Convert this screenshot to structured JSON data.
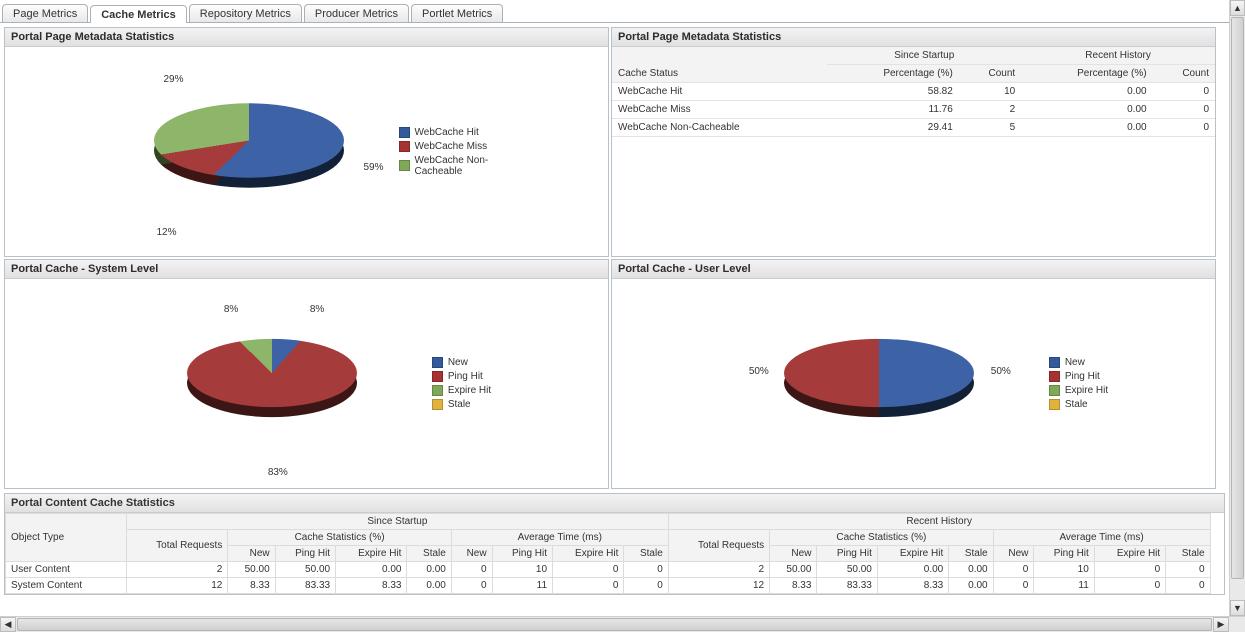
{
  "tabs": [
    "Page Metrics",
    "Cache Metrics",
    "Repository Metrics",
    "Producer Metrics",
    "Portlet Metrics"
  ],
  "tabs_active_index": 1,
  "panel_titles": {
    "meta_pie": "Portal Page Metadata Statistics",
    "meta_table": "Portal Page Metadata Statistics",
    "cache_system": "Portal Cache - System Level",
    "cache_user": "Portal Cache - User Level",
    "content": "Portal Content Cache Statistics"
  },
  "colors": {
    "blue": "#3d63a6",
    "red": "#a63b3b",
    "green": "#8eb66a",
    "orange": "#e2b33c"
  },
  "legend_webcache": [
    "WebCache Hit",
    "WebCache Miss",
    "WebCache Non-Cacheable"
  ],
  "legend_cache": [
    "New",
    "Ping Hit",
    "Expire Hit",
    "Stale"
  ],
  "meta_table": {
    "headers": {
      "cache_status": "Cache Status",
      "since_startup": "Since Startup",
      "recent_history": "Recent History",
      "percentage": "Percentage (%)",
      "count": "Count"
    },
    "rows": [
      {
        "label": "WebCache Hit",
        "s_pct": "58.82",
        "s_cnt": "10",
        "r_pct": "0.00",
        "r_cnt": "0"
      },
      {
        "label": "WebCache Miss",
        "s_pct": "11.76",
        "s_cnt": "2",
        "r_pct": "0.00",
        "r_cnt": "0"
      },
      {
        "label": "WebCache Non-Cacheable",
        "s_pct": "29.41",
        "s_cnt": "5",
        "r_pct": "0.00",
        "r_cnt": "0"
      }
    ]
  },
  "chart_data": [
    {
      "id": "meta_pie",
      "type": "pie",
      "title": "Portal Page Metadata Statistics",
      "series": [
        {
          "name": "WebCache Hit",
          "value": 59
        },
        {
          "name": "WebCache Miss",
          "value": 12
        },
        {
          "name": "WebCache Non-Cacheable",
          "value": 29
        }
      ],
      "labels": {
        "hit": "59%",
        "miss": "12%",
        "non": "29%"
      }
    },
    {
      "id": "cache_system",
      "type": "pie",
      "title": "Portal Cache - System Level",
      "series": [
        {
          "name": "New",
          "value": 8
        },
        {
          "name": "Ping Hit",
          "value": 83
        },
        {
          "name": "Expire Hit",
          "value": 8
        },
        {
          "name": "Stale",
          "value": 0
        }
      ],
      "labels": {
        "new": "8%",
        "ping": "83%",
        "expire": "8%"
      }
    },
    {
      "id": "cache_user",
      "type": "pie",
      "title": "Portal Cache - User Level",
      "series": [
        {
          "name": "New",
          "value": 50
        },
        {
          "name": "Ping Hit",
          "value": 50
        },
        {
          "name": "Expire Hit",
          "value": 0
        },
        {
          "name": "Stale",
          "value": 0
        }
      ],
      "labels": {
        "new": "50%",
        "ping": "50%"
      }
    }
  ],
  "content_table": {
    "headers": {
      "object_type": "Object Type",
      "since_startup": "Since Startup",
      "recent_history": "Recent History",
      "total_requests": "Total Requests",
      "cache_stats": "Cache Statistics (%)",
      "avg_time": "Average Time (ms)",
      "new": "New",
      "ping_hit": "Ping Hit",
      "expire_hit": "Expire Hit",
      "stale": "Stale"
    },
    "rows": [
      {
        "obj": "User Content",
        "s_total": "2",
        "s_new": "50.00",
        "s_ping": "50.00",
        "s_exp": "0.00",
        "s_stale": "0.00",
        "s_t_new": "0",
        "s_t_ping": "10",
        "s_t_exp": "0",
        "s_t_stale": "0",
        "r_total": "2",
        "r_new": "50.00",
        "r_ping": "50.00",
        "r_exp": "0.00",
        "r_stale": "0.00",
        "r_t_new": "0",
        "r_t_ping": "10",
        "r_t_exp": "0",
        "r_t_stale": "0"
      },
      {
        "obj": "System Content",
        "s_total": "12",
        "s_new": "8.33",
        "s_ping": "83.33",
        "s_exp": "8.33",
        "s_stale": "0.00",
        "s_t_new": "0",
        "s_t_ping": "11",
        "s_t_exp": "0",
        "s_t_stale": "0",
        "r_total": "12",
        "r_new": "8.33",
        "r_ping": "83.33",
        "r_exp": "8.33",
        "r_stale": "0.00",
        "r_t_new": "0",
        "r_t_ping": "11",
        "r_t_exp": "0",
        "r_t_stale": "0"
      }
    ]
  }
}
